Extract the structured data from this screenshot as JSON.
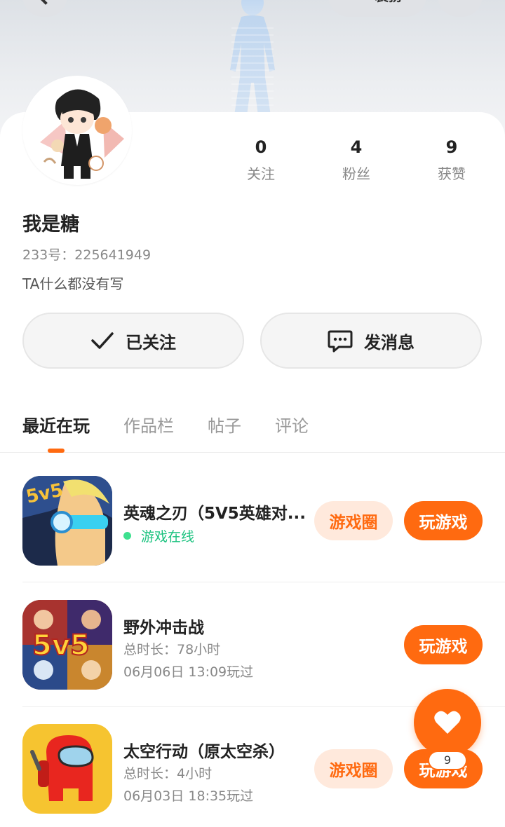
{
  "header": {
    "dress_label": "装扮"
  },
  "profile": {
    "name": "我是糖",
    "uid": "233号：225641949",
    "bio": "TA什么都没有写",
    "stats": [
      {
        "value": "0",
        "label": "关注"
      },
      {
        "value": "4",
        "label": "粉丝"
      },
      {
        "value": "9",
        "label": "获赞"
      }
    ]
  },
  "actions": {
    "follow_label": "已关注",
    "message_label": "发消息"
  },
  "tabs": [
    {
      "label": "最近在玩",
      "active": true
    },
    {
      "label": "作品栏",
      "active": false
    },
    {
      "label": "帖子",
      "active": false
    },
    {
      "label": "评论",
      "active": false
    }
  ],
  "games": [
    {
      "title": "英魂之刃（5V5英雄对...",
      "status": "游戏在线",
      "circle_label": "游戏圈",
      "play_label": "玩游戏"
    },
    {
      "title": "野外冲击战",
      "duration": "总时长：78小时",
      "last_played": "06月06日 13:09玩过",
      "play_label": "玩游戏"
    },
    {
      "title": "太空行动（原太空杀）",
      "duration": "总时长：4小时",
      "last_played": "06月03日 18:35玩过",
      "circle_label": "游戏圈",
      "play_label": "玩游戏"
    }
  ],
  "like_fab": {
    "count": "9",
    "icon": "heart-icon"
  },
  "colors": {
    "accent": "#ff6a10",
    "accent_light": "#ffe9dc",
    "online": "#19c27e"
  }
}
